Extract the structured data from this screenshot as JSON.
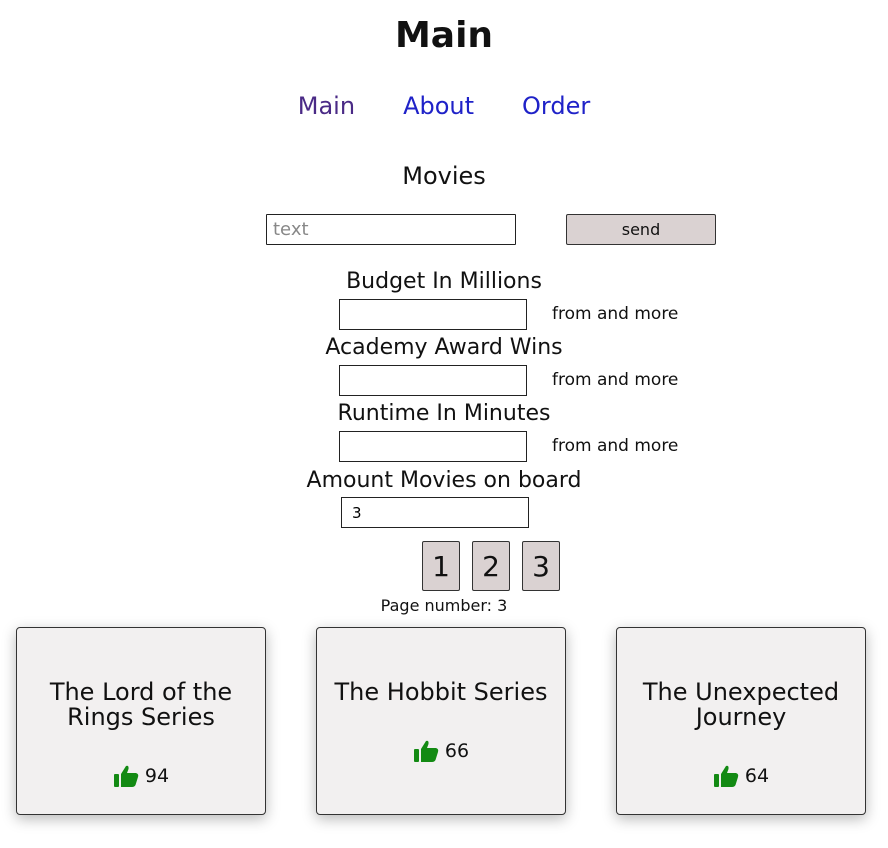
{
  "header": {
    "title": "Main"
  },
  "nav": {
    "items": [
      {
        "label": "Main"
      },
      {
        "label": "About"
      },
      {
        "label": "Order"
      }
    ]
  },
  "main": {
    "section_title": "Movies",
    "search": {
      "placeholder": "text",
      "value": ""
    },
    "send_label": "send",
    "filters": [
      {
        "label": "Budget In Millions",
        "value": "",
        "hint": "from and more"
      },
      {
        "label": "Academy Award Wins",
        "value": "",
        "hint": "from and more"
      },
      {
        "label": "Runtime In Minutes",
        "value": "",
        "hint": "from and more"
      }
    ],
    "amount": {
      "label": "Amount Movies on board",
      "value": "3"
    },
    "pagination": {
      "pages": [
        "1",
        "2",
        "3"
      ],
      "page_number_text": "Page number: 3"
    },
    "cards": [
      {
        "title": "The Lord of the Rings Series",
        "likes": "94"
      },
      {
        "title": "The Hobbit Series",
        "likes": "66"
      },
      {
        "title": "The Unexpected Journey",
        "likes": "64"
      }
    ]
  },
  "colors": {
    "visited_link": "#4a2a86",
    "link": "#1f22c8",
    "button_bg": "#dad2d2",
    "card_bg": "#f2f0f0",
    "thumb": "#138a13"
  },
  "icons": {
    "like": "thumbs-up-icon"
  }
}
